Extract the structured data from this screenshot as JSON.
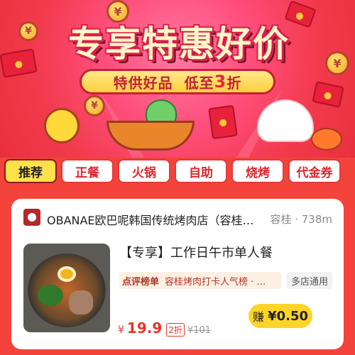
{
  "banner": {
    "title": "专享特惠好价",
    "subtitle_prefix": "特供好品  低至",
    "subtitle_highlight": "3",
    "subtitle_suffix": "折",
    "coin_symbol": "¥"
  },
  "tabs": [
    {
      "label": "推荐",
      "active": true
    },
    {
      "label": "正餐",
      "active": false
    },
    {
      "label": "火锅",
      "active": false
    },
    {
      "label": "自助",
      "active": false
    },
    {
      "label": "烧烤",
      "active": false
    },
    {
      "label": "代金券",
      "active": false
    }
  ],
  "card": {
    "shop_name": "OBANAE欧巴呢韩国传统烤肉店（容桂…",
    "shop_meta": "容桂 · 738m",
    "deal_title": "【专享】工作日午市单人餐",
    "rank_label": "点评榜单",
    "rank_text": "容桂烤肉打卡人气榜 · …",
    "multi_store": "多店通用",
    "price_currency": "¥",
    "price_value": "19.9",
    "discount": "2折",
    "original_price": "¥101",
    "earn_label": "赚 ",
    "earn_amount": "¥0.50"
  },
  "colors": {
    "page_bg": "#f4433a",
    "tab_active": "#ffe24a",
    "price": "#e8352a",
    "earn_button": "#ffd42a"
  }
}
